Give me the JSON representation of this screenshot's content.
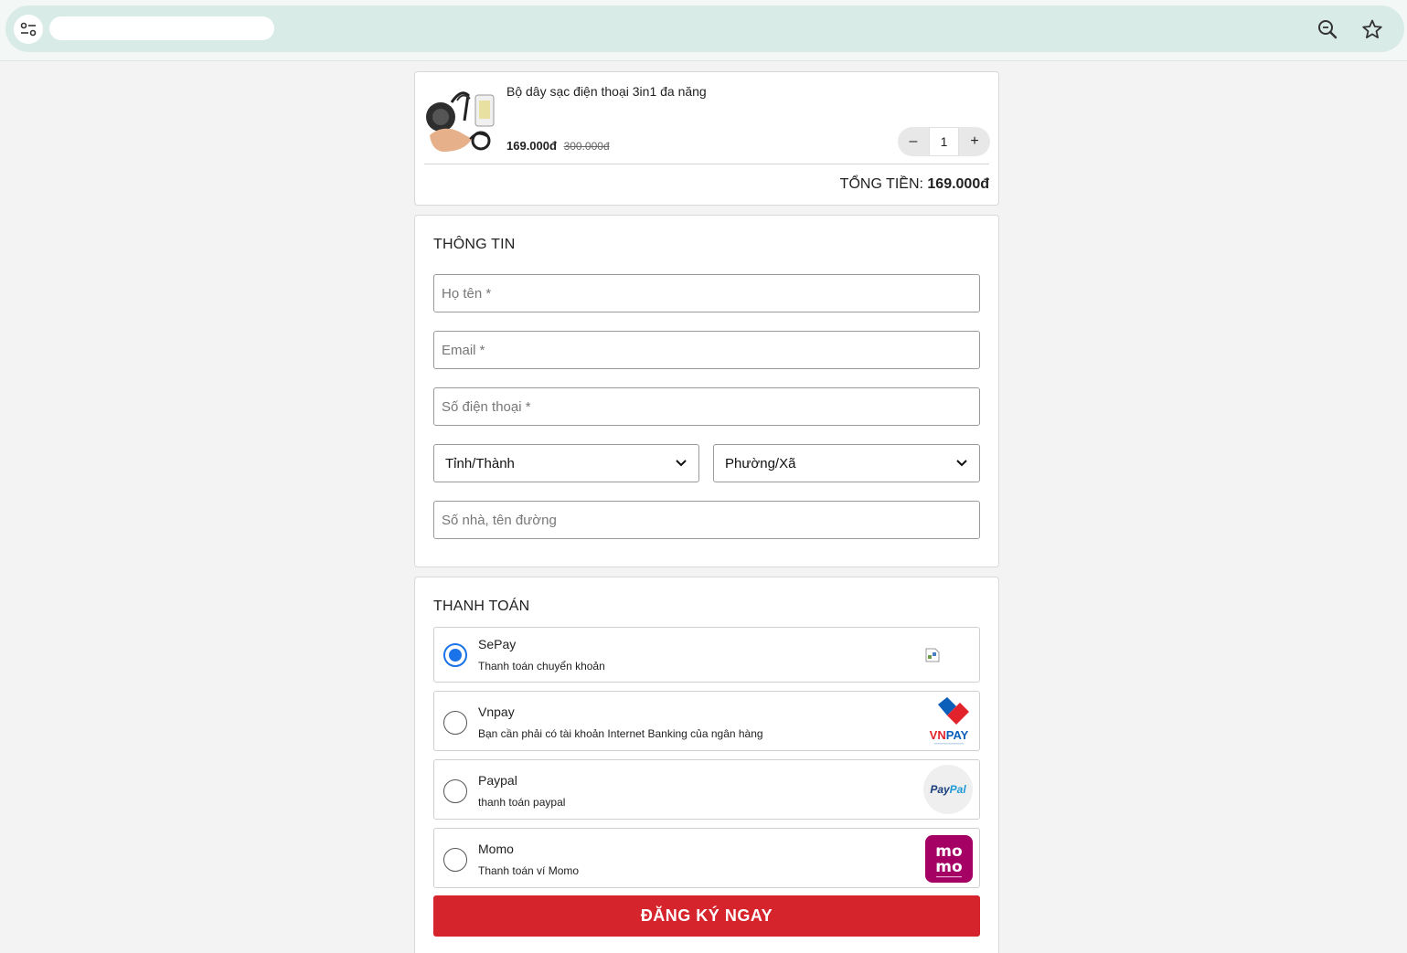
{
  "browser": {
    "tune_icon": "tune-icon",
    "zoom_icon": "zoom-icon",
    "bookmark_icon": "star-icon"
  },
  "cart": {
    "product_name": "Bộ dây sạc điện thoại 3in1 đa năng",
    "price_new": "169.000đ",
    "price_old": "300.000đ",
    "quantity": "1",
    "minus_label": "–",
    "plus_label": "+",
    "total_label": "TỔNG TIỀN:",
    "total_value": "169.000đ"
  },
  "info": {
    "title": "THÔNG TIN",
    "name_placeholder": "Họ tên *",
    "email_placeholder": "Email *",
    "phone_placeholder": "Số điện thoại *",
    "province_selected": "Tỉnh/Thành",
    "ward_selected": "Phường/Xã",
    "address_placeholder": "Số nhà, tên đường"
  },
  "payment": {
    "title": "THANH TOÁN",
    "options": [
      {
        "name": "SePay",
        "desc": "Thanh toán chuyển khoản",
        "selected": true
      },
      {
        "name": "Vnpay",
        "desc": "Bạn cần phải có tài khoản Internet Banking của ngân hàng",
        "selected": false,
        "logo_text": "VNPAY"
      },
      {
        "name": "Paypal",
        "desc": "thanh toán paypal",
        "selected": false,
        "logo_text": "PayPal"
      },
      {
        "name": "Momo",
        "desc": "Thanh toán ví Momo",
        "selected": false,
        "logo_text": "mo mo"
      }
    ],
    "submit_label": "ĐĂNG KÝ NGAY"
  },
  "colors": {
    "accent": "#d6242c",
    "radio_selected": "#1a73e8",
    "omnibox": "#d8ebe6"
  }
}
